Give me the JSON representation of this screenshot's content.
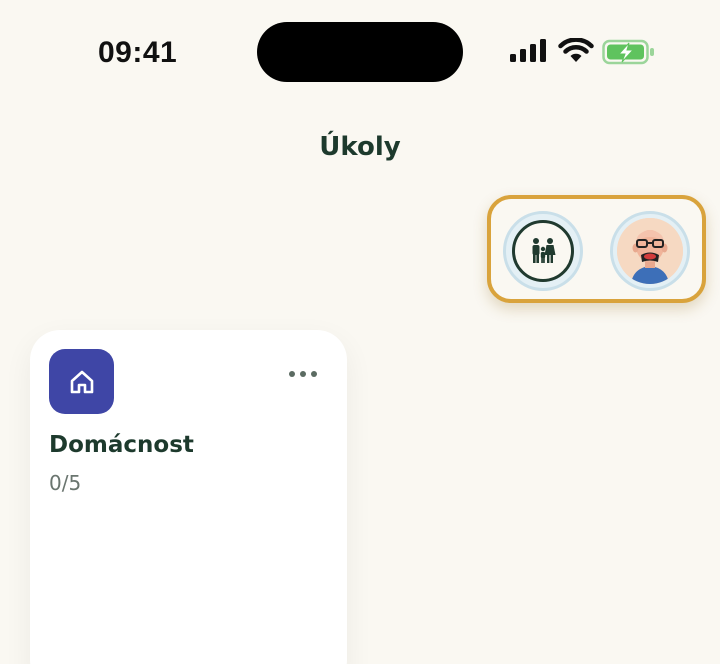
{
  "status_bar": {
    "time": "09:41"
  },
  "header": {
    "title": "Úkoly"
  },
  "member_switcher": {
    "members": [
      {
        "name": "family",
        "icon": "family-icon"
      },
      {
        "name": "user",
        "icon": "user-avatar"
      }
    ],
    "highlight_color": "#d9a33c"
  },
  "categories": [
    {
      "name": "Domácnost",
      "progress": "0/5",
      "icon": "home-icon",
      "color": "#3f46a6"
    }
  ]
}
